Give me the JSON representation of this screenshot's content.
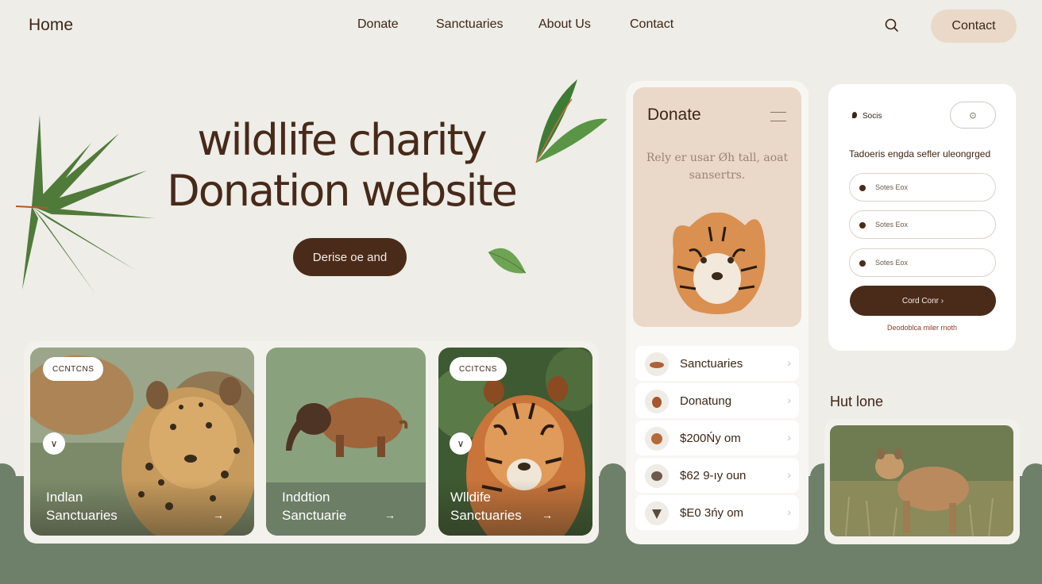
{
  "nav": {
    "home": "Home",
    "links": [
      "Donate",
      "Sanctuaries",
      "About Us",
      "Contact"
    ],
    "search_icon": "search-icon",
    "contact_button": "Contact"
  },
  "hero": {
    "title_line1": "wildlife charity",
    "title_line2": "Donation website",
    "cta": "Derise oe and"
  },
  "cards": [
    {
      "badge": "CCNTCNS",
      "line1": "Indlan",
      "line2": "Sanctuaries",
      "arrow": "→",
      "bookmark": "∨"
    },
    {
      "line1": "Inddtion",
      "line2": "Sanctuarie",
      "arrow": "→"
    },
    {
      "badge": "CCITCNS",
      "line1": "Wlldife",
      "line2": "Sanctuaries",
      "arrow": "→",
      "bookmark": "∨"
    }
  ],
  "phone": {
    "title": "Donate",
    "subtitle": "Rely er usar Øh tall, aoat sansertrs.",
    "list": [
      {
        "label": "Sanctuaries",
        "icon": "fox-icon"
      },
      {
        "label": "Donatung",
        "icon": "squirrel-icon"
      },
      {
        "label": "$200Ńy om",
        "icon": "lion-icon"
      },
      {
        "label": "$62 9-ıy oun",
        "icon": "elephant-icon"
      },
      {
        "label": "$E0 3ńy om",
        "icon": "wolf-icon"
      }
    ],
    "chevron": "›"
  },
  "form": {
    "label": "Socis",
    "toggle_icon": "⊙",
    "heading": "Tadoeris engda sefler uleongrged",
    "fields": [
      "Sotes Eox",
      "Sotes Eox",
      "Sotes Eox"
    ],
    "button": "Cord Conr ›",
    "footer": "Deodoblca miler rnoth"
  },
  "hut": {
    "label": "Hut lone"
  },
  "colors": {
    "background": "#eeede7",
    "brown": "#4a2b1a",
    "peach": "#ead8c8",
    "sage": "#6f806a"
  }
}
